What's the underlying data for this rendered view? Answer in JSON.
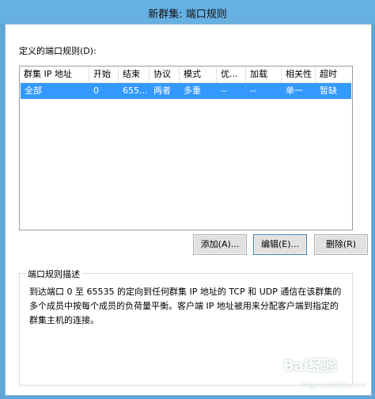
{
  "window": {
    "title": "新群集: 端口规则"
  },
  "rules": {
    "label": "定义的端口规则(D):",
    "columns": [
      "群集 IP 地址",
      "开始",
      "结束",
      "协议",
      "模式",
      "优...",
      "加载",
      "相关性",
      "超时"
    ],
    "rows": [
      {
        "cluster_ip": "全部",
        "start": "0",
        "end": "655...",
        "protocol": "两者",
        "mode": "多重",
        "priority": "--",
        "load": "--",
        "affinity": "单一",
        "timeout": "暂缺"
      }
    ]
  },
  "buttons": {
    "add": "添加(A)...",
    "edit": "编辑(E)...",
    "remove": "删除(R)"
  },
  "description": {
    "title": "端口规则描述",
    "text": "到达端口 0 至 65535 的定向到任何群集 IP 地址的 TCP 和 UDP 通信在该群集的多个成员中按每个成员的负荷量平衡。客户端 IP 地址被用来分配客户端到指定的群集主机的连接。"
  },
  "watermark": {
    "text": "Bai经验",
    "sub": "jingyan.baidu.com"
  },
  "colors": {
    "titlebar": "#67b0e2",
    "selection": "#3399ff",
    "frame": "#5fa6d8"
  }
}
